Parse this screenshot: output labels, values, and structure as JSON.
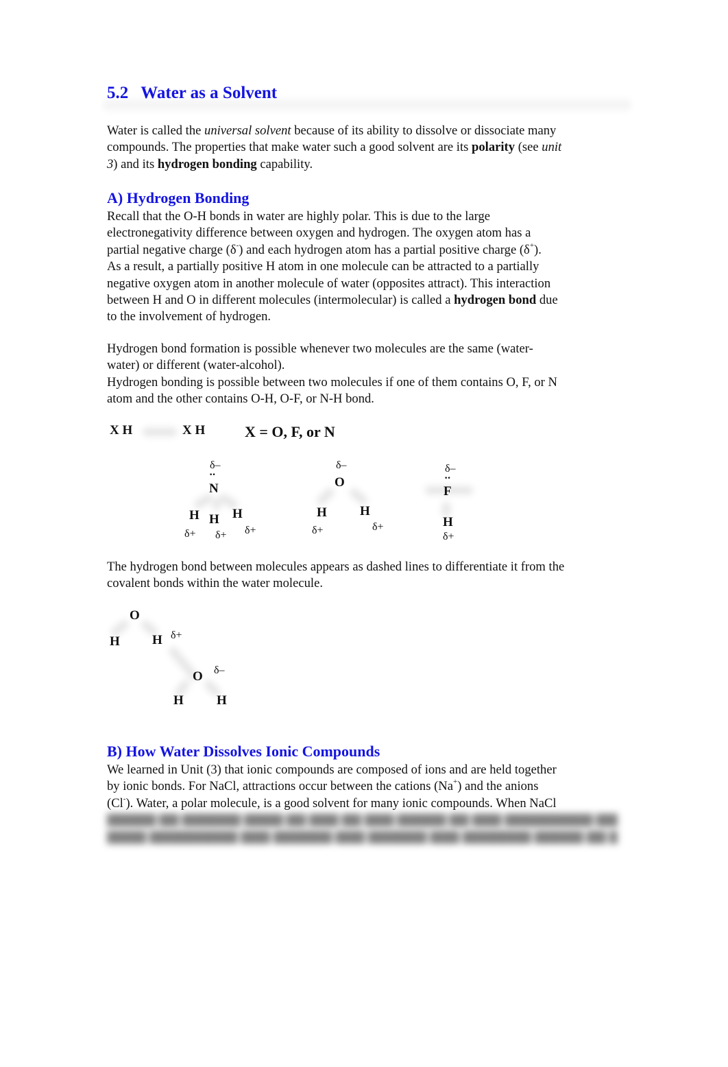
{
  "section": {
    "number": "5.2",
    "title": "Water as a Solvent"
  },
  "intro": {
    "line1_a": "Water is called the ",
    "line1_em": "universal solvent",
    "line1_b": " because of its ability to dissolve or dissociate many",
    "line2_a": "compounds. The properties that make water such a good solvent are its ",
    "line2_strong": "polarity",
    "line2_b": " (see ",
    "line2_em": "unit",
    "line3_em": "3",
    "line3_a": ") and its ",
    "line3_strong": "hydrogen bonding",
    "line3_b": " capability."
  },
  "section_a": {
    "heading": "A) Hydrogen Bonding",
    "p1": {
      "l1": "Recall that the O-H bonds in water are highly polar. This is due to the large",
      "l2": "electronegativity difference between oxygen and hydrogen. The oxygen atom has a",
      "l3_a": "partial negative charge (δ",
      "l3_sup1": "-",
      "l3_b": ") and each hydrogen atom has a partial positive charge (δ",
      "l3_sup2": "+",
      "l3_c": ").",
      "l4": "As a result, a partially positive H atom in one molecule can be attracted to a partially",
      "l5": "negative oxygen atom in another molecule of water (opposites attract). This interaction",
      "l6_a": "between H and O in different molecules (intermolecular) is called a ",
      "l6_strong": "hydrogen bond",
      "l6_b": " due",
      "l7": "to the involvement of hydrogen."
    },
    "p2": {
      "l1": "Hydrogen bond formation is possible whenever two molecules are the same (water-",
      "l2": "water) or different (water-alcohol).",
      "l3": "Hydrogen bonding is possible between two molecules if one of them contains O, F, or N",
      "l4": "atom and the other contains O-H, O-F, or N-H bond."
    },
    "xh_diagram": {
      "left": "X H",
      "right": "X H",
      "definition": "X = O, F, or N"
    },
    "molecules": {
      "ammonia": {
        "center": "N",
        "lone_pair": "··",
        "center_charge": "δ–",
        "hydrogens": [
          "H",
          "H",
          "H"
        ],
        "h_charge": "δ+"
      },
      "water": {
        "center": "O",
        "center_charge": "δ–",
        "hydrogens": [
          "H",
          "H"
        ],
        "h_charge": "δ+"
      },
      "hydrogen_fluoride": {
        "center": "F",
        "lone_pair": "··",
        "center_charge": "δ–",
        "hydrogens": [
          "H"
        ],
        "h_charge": "δ+"
      }
    },
    "p3": {
      "l1": "The hydrogen bond between molecules appears as dashed lines to differentiate it from the",
      "l2": "covalent bonds within the water molecule."
    },
    "dimer": {
      "o1": "O",
      "h1a": "H",
      "h1b": "H",
      "h1b_charge": "δ+",
      "o2": "O",
      "o2_charge": "δ–",
      "h2a": "H",
      "h2b": "H"
    }
  },
  "section_b": {
    "heading": "B) How Water Dissolves Ionic Compounds",
    "p1": {
      "l1": "We learned in Unit (3) that ionic compounds are composed of ions and are held together",
      "l2_a": "by ionic bonds. For NaCl, attractions occur between the cations (Na",
      "l2_sup": "+",
      "l2_b": ") and the anions",
      "l3_a": "(Cl",
      "l3_sup": "-",
      "l3_b": "). Water, a polar molecule, is a good solvent for many ionic compounds. When NaCl"
    }
  }
}
